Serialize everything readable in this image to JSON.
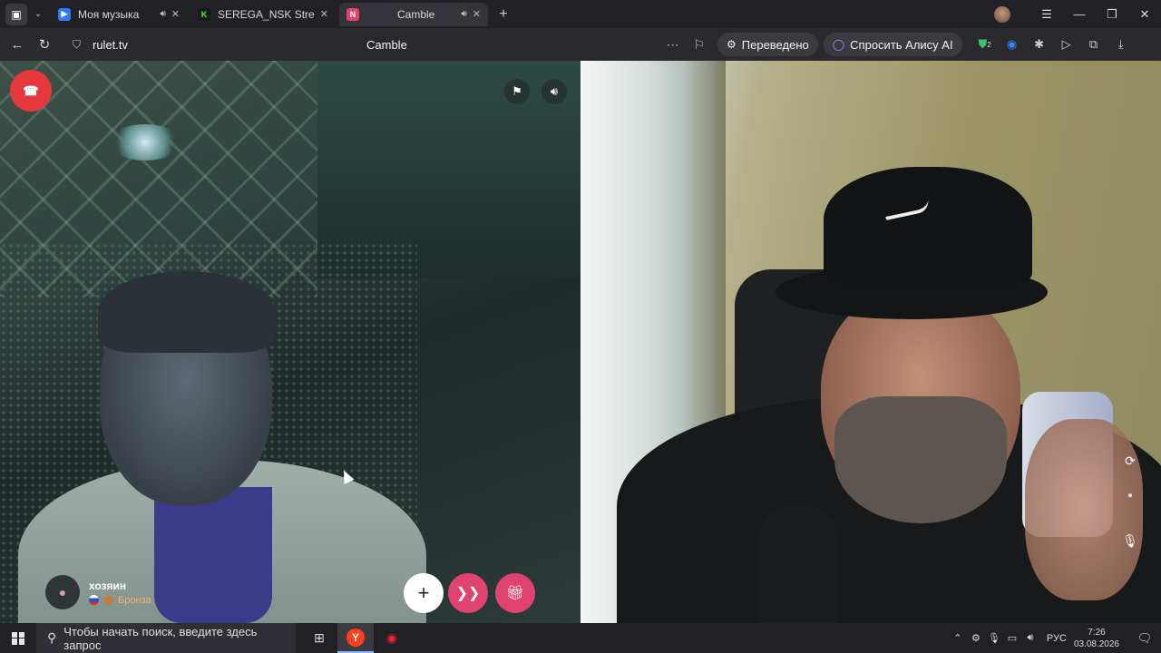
{
  "tabs": [
    {
      "title": "Моя музыка",
      "favicon_color": "#2e7bf6",
      "sound": true,
      "active": false
    },
    {
      "title": "SEREGA_NSK Stream - Wa",
      "favicon_color": "#53fc18",
      "sound": false,
      "active": false
    },
    {
      "title": "Camble",
      "favicon_color": "#e0436f",
      "sound": true,
      "active": true
    }
  ],
  "address": {
    "domain": "rulet.tv",
    "page_title": "Camble"
  },
  "toolbar": {
    "translated_label": "Переведено",
    "ask_alice_label": "Спросить Алису AI",
    "ext_badge": "2"
  },
  "user": {
    "name": "хозяин",
    "rank": "Бронза",
    "country": "RU"
  },
  "icons": {
    "hangup": "phone-hangup-icon",
    "flag": "report-flag-icon",
    "volume": "volume-icon",
    "add": "plus-icon",
    "next": "next-chevrons-icon",
    "gift": "gift-icon",
    "rotate": "camera-rotate-icon",
    "mic": "microphone-icon"
  },
  "colors": {
    "accent": "#e0436f",
    "hangup": "#e5383b",
    "rank": "#f4b26b"
  },
  "taskbar": {
    "search_placeholder": "Чтобы начать поиск, введите здесь запрос",
    "language": "РУС",
    "time": "7:26",
    "date": "03.08.2026"
  }
}
